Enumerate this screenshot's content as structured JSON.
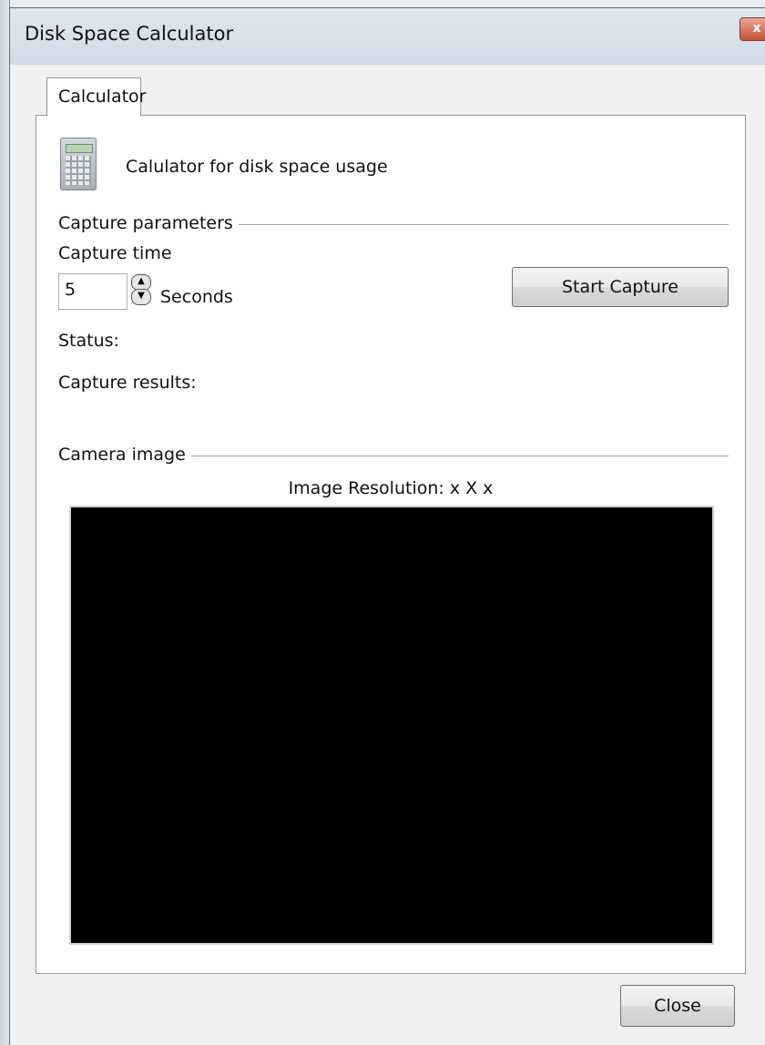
{
  "window": {
    "title": "Disk Space Calculator",
    "close_glyph": "x"
  },
  "tabs": [
    {
      "label": "Calculator",
      "selected": true
    }
  ],
  "header": {
    "icon": "calculator-icon",
    "description": "Calulator for disk space usage"
  },
  "capture_parameters": {
    "group_label": "Capture parameters",
    "time_label": "Capture time",
    "time_value": "5",
    "unit_label": "Seconds",
    "start_button": "Start Capture"
  },
  "status": {
    "label": "Status:"
  },
  "results": {
    "label": "Capture results:"
  },
  "camera": {
    "group_label": "Camera image",
    "resolution_text": "Image Resolution: x X x"
  },
  "footer": {
    "close_button": "Close"
  }
}
